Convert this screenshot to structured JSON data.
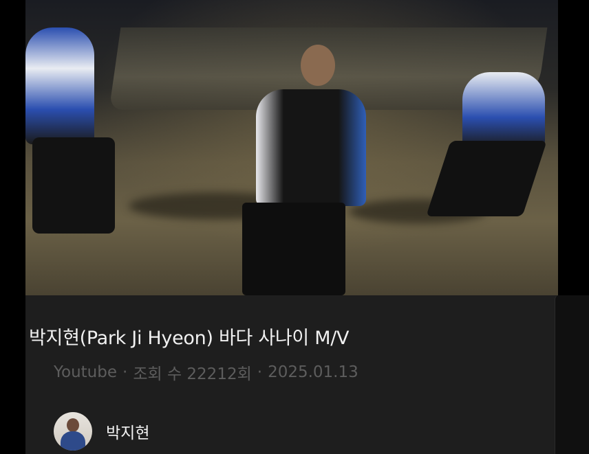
{
  "video": {
    "thumbnail_icon": "music-video-thumbnail"
  },
  "post": {
    "title": "박지현(Park Ji Hyeon) 바다 사나이 M/V",
    "source": "Youtube",
    "separator": "·",
    "views": "조회 수 22212회",
    "date": "2025.01.13"
  },
  "author": {
    "name": "박지현",
    "avatar_icon": "avatar-icon"
  },
  "colors": {
    "card_background": "#1e1e1e",
    "title_text": "#f1f1f1",
    "meta_text": "#5d5d5d"
  }
}
